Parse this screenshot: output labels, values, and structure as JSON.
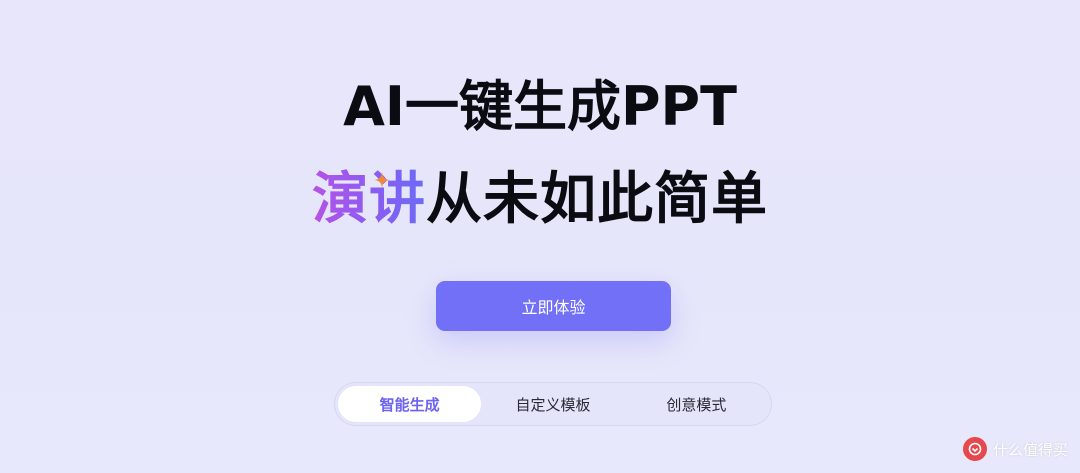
{
  "hero": {
    "title_line1": "AI一键生成PPT",
    "title_line2_highlight": "演讲",
    "title_line2_rest": "从未如此简单"
  },
  "cta": {
    "label": "立即体验"
  },
  "mode_tabs": [
    {
      "label": "智能生成",
      "active": true
    },
    {
      "label": "自定义模板",
      "active": false
    },
    {
      "label": "创意模式",
      "active": false
    }
  ],
  "watermark": {
    "text": "什么值得买"
  },
  "colors": {
    "accent": "#7270f6",
    "highlight_gradient_start": "#b653e6",
    "highlight_gradient_end": "#6a6cf6",
    "sparkle": "#f08a3a",
    "background": "#e7e7fb"
  }
}
